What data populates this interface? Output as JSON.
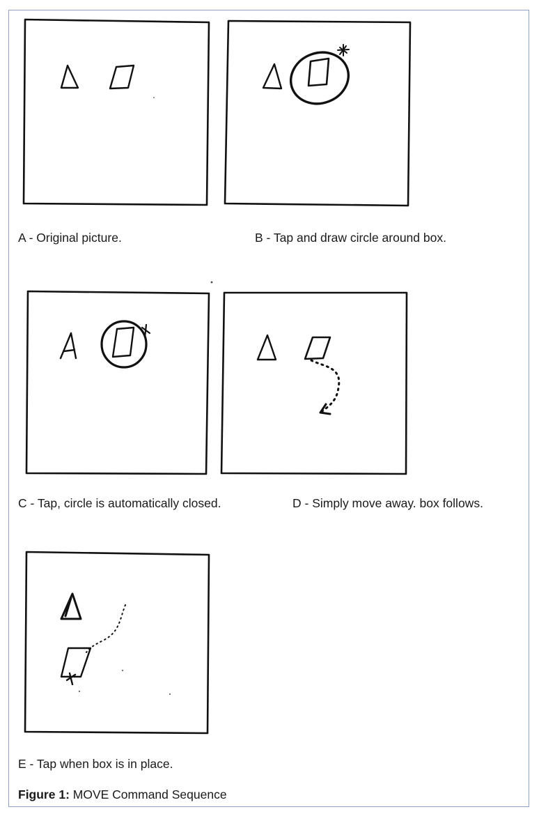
{
  "panels": {
    "a": {
      "caption": "A - Original picture."
    },
    "b": {
      "caption": "B - Tap and draw circle around box."
    },
    "c": {
      "caption": "C - Tap, circle is automatically closed."
    },
    "d": {
      "caption": "D - Simply move away. box follows."
    },
    "e": {
      "caption": "E - Tap when box is in place."
    }
  },
  "figure": {
    "label": "Figure 1:",
    "title": " MOVE Command Sequence"
  }
}
